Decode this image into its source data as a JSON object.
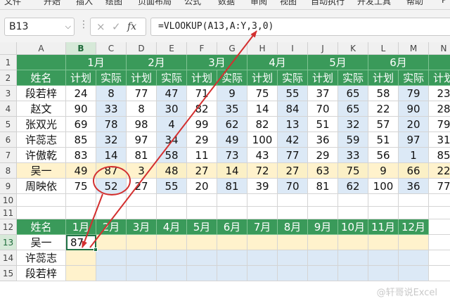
{
  "ribbon": {
    "tabs": [
      "文件",
      "开始",
      "插入",
      "绘图",
      "页面布局",
      "公式",
      "数据",
      "审阅",
      "视图",
      "自动执行",
      "开发工具",
      "帮助",
      "P"
    ]
  },
  "formula_bar": {
    "name_box": "B13",
    "cancel_glyph": "×",
    "confirm_glyph": "✓",
    "fx_label": "fx",
    "formula": "=VLOOKUP(A13,A:Y,3,0)"
  },
  "columns": [
    "A",
    "B",
    "C",
    "D",
    "E",
    "F",
    "G",
    "H",
    "I",
    "J",
    "K",
    "L",
    "M",
    "N"
  ],
  "rows": [
    "1",
    "2",
    "3",
    "4",
    "5",
    "6",
    "7",
    "8",
    "9",
    "10",
    "11",
    "12",
    "13",
    "14",
    "15"
  ],
  "table1": {
    "name_header": "姓名",
    "months": [
      "1月",
      "2月",
      "3月",
      "4月",
      "5月",
      "6月"
    ],
    "sub_headers": [
      "计划",
      "实际"
    ],
    "rows": [
      {
        "name": "段若梓",
        "values": [
          "24",
          "8",
          "77",
          "47",
          "71",
          "9",
          "75",
          "55",
          "37",
          "65",
          "58",
          "79",
          "23"
        ]
      },
      {
        "name": "赵文",
        "values": [
          "90",
          "33",
          "8",
          "30",
          "82",
          "35",
          "14",
          "84",
          "70",
          "65",
          "22",
          "90",
          "28"
        ]
      },
      {
        "name": "张双光",
        "values": [
          "69",
          "78",
          "98",
          "4",
          "99",
          "62",
          "82",
          "13",
          "51",
          "32",
          "57",
          "20",
          "79"
        ]
      },
      {
        "name": "许蕊志",
        "values": [
          "85",
          "32",
          "97",
          "34",
          "29",
          "49",
          "100",
          "42",
          "36",
          "59",
          "51",
          "97",
          "31"
        ]
      },
      {
        "name": "许傲乾",
        "values": [
          "83",
          "14",
          "81",
          "58",
          "11",
          "73",
          "43",
          "77",
          "29",
          "33",
          "56",
          "1",
          "85"
        ]
      },
      {
        "name": "吴一",
        "values": [
          "49",
          "87",
          "3",
          "48",
          "27",
          "14",
          "72",
          "27",
          "63",
          "75",
          "9",
          "66",
          "22"
        ]
      },
      {
        "name": "周映依",
        "values": [
          "75",
          "52",
          "27",
          "55",
          "20",
          "81",
          "39",
          "70",
          "81",
          "62",
          "100",
          "36",
          "77"
        ]
      }
    ]
  },
  "table2": {
    "name_header": "姓名",
    "months": [
      "1月",
      "2月",
      "3月",
      "4月",
      "5月",
      "6月",
      "7月",
      "8月",
      "9月",
      "10月",
      "11月",
      "12月"
    ],
    "rows": [
      {
        "name": "吴一",
        "first_value": "87"
      },
      {
        "name": "许蕊志",
        "first_value": ""
      },
      {
        "name": "段若梓",
        "first_value": ""
      }
    ]
  },
  "colors": {
    "header_green": "#3a9a5a",
    "plan_white": "#ffffff",
    "actual_blue": "#dce9f6",
    "highlight_yellow": "#fff2cc",
    "annotation_red": "#d32f2f",
    "selection_green": "#217346"
  },
  "watermark": "@轩哥说Excel"
}
